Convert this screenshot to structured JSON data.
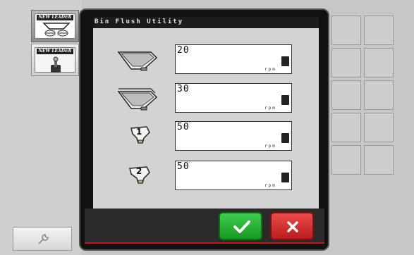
{
  "sidebar": {
    "buttons": [
      {
        "logo": "NEW LEADER",
        "icon": "spinner-bin-icon",
        "active": true
      },
      {
        "logo": "NEW LEADER",
        "icon": "toggle-switch-icon",
        "active": false
      }
    ],
    "tool_icon": "wrench-icon"
  },
  "window": {
    "title": "Bin Flush Utility"
  },
  "rows": [
    {
      "icon": "main-bin-icon",
      "value": "20",
      "unit": "rpm"
    },
    {
      "icon": "double-bin-icon",
      "value": "30",
      "unit": "rpm"
    },
    {
      "icon": "bin-1-icon",
      "label": "1",
      "value": "50",
      "unit": "rpm"
    },
    {
      "icon": "bin-2-icon",
      "label": "2",
      "value": "50",
      "unit": "rpm"
    }
  ],
  "actions": {
    "confirm_icon": "check-icon",
    "cancel_icon": "close-icon",
    "confirm_color": "#2bb33a",
    "cancel_color": "#d63030"
  },
  "colors": {
    "accent_red": "#c31515"
  }
}
